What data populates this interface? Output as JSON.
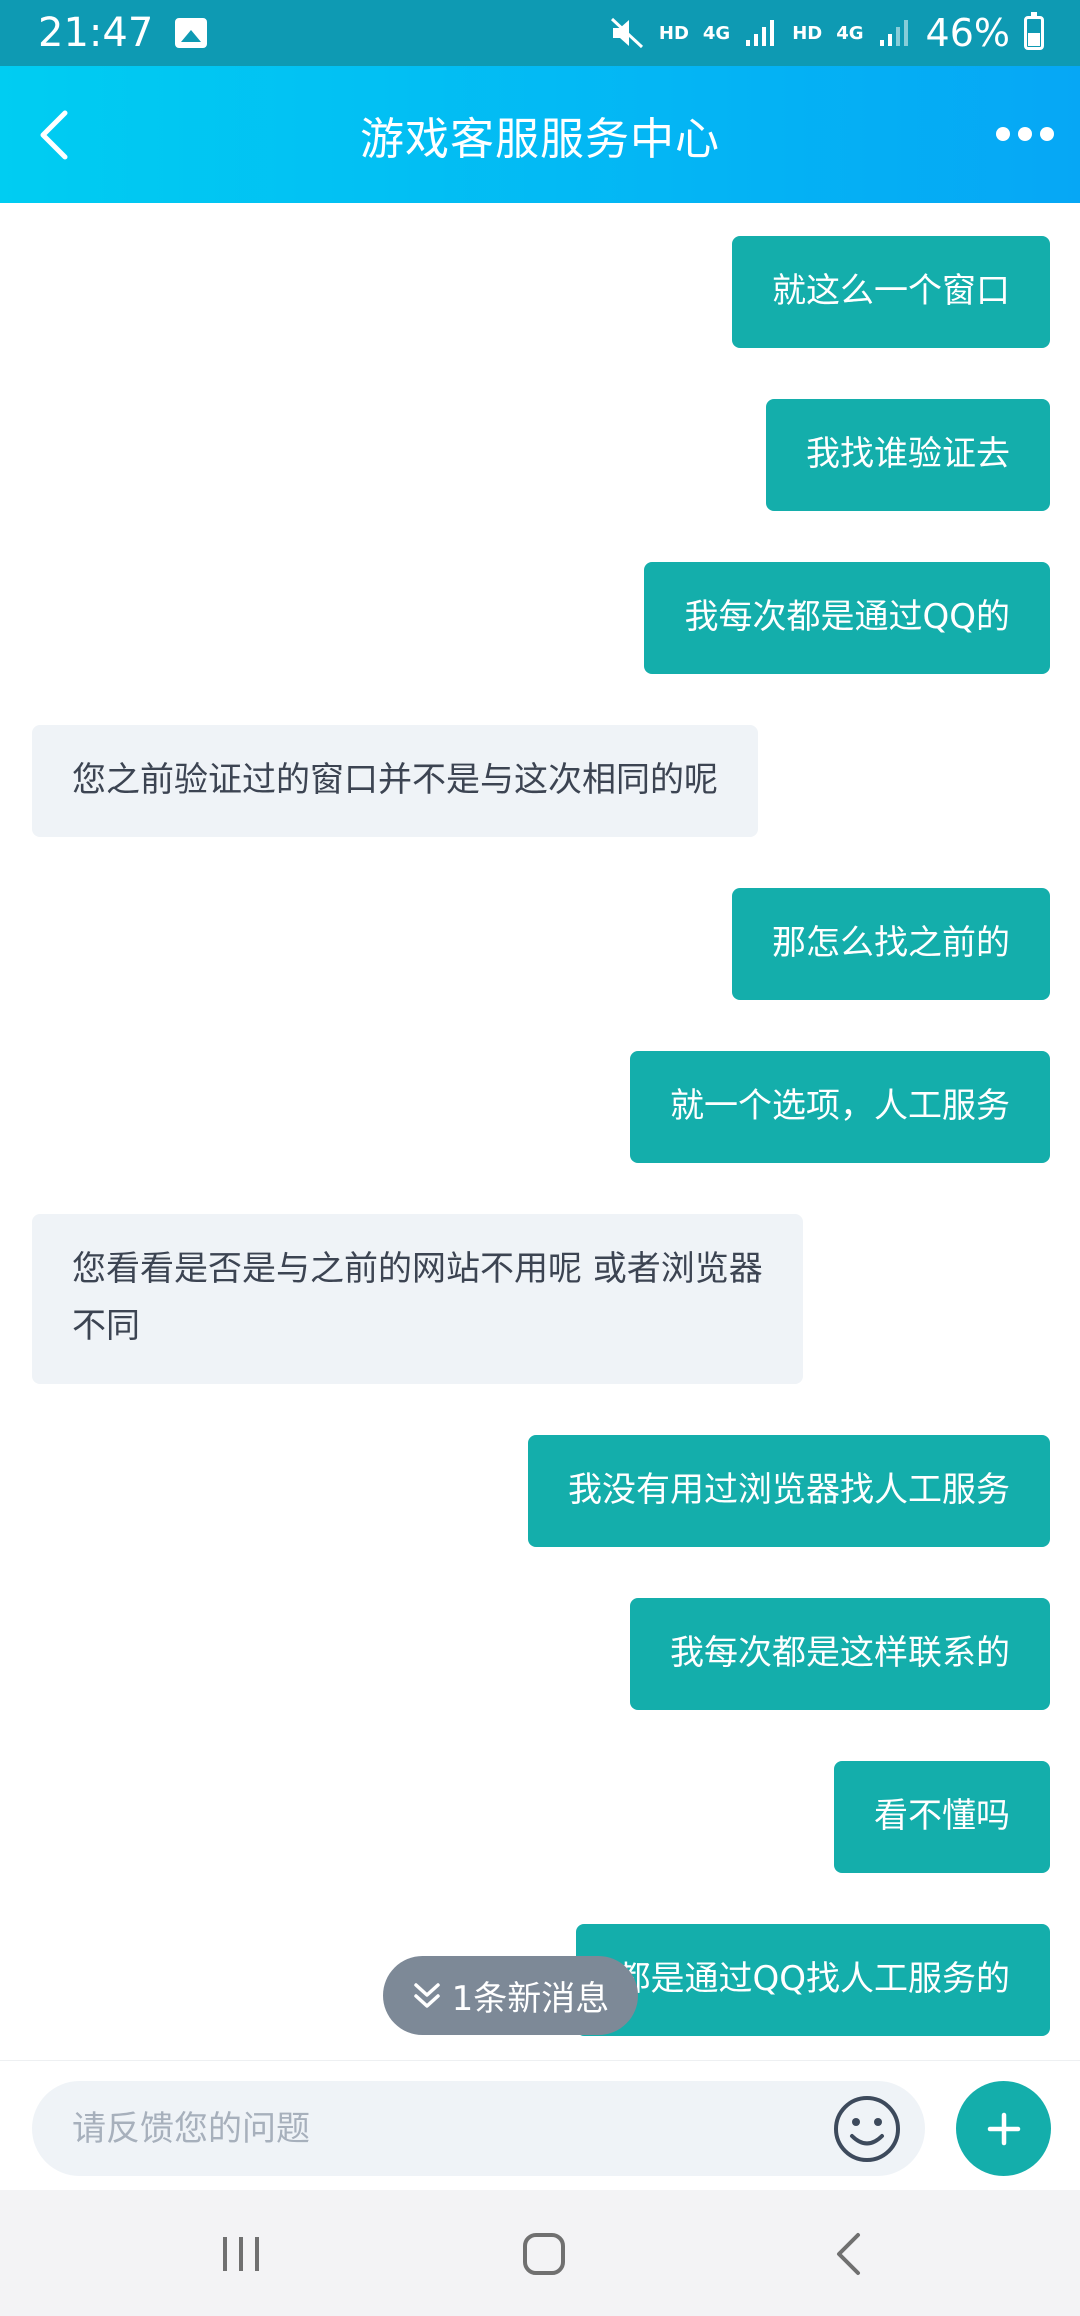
{
  "status_bar": {
    "time": "21:47",
    "net1": "HD",
    "net2": "4G",
    "net3": "HD",
    "net4": "4G",
    "battery": "46%"
  },
  "header": {
    "title": "游戏客服服务中心"
  },
  "messages": [
    {
      "from": "me",
      "text": "就这么一个窗口"
    },
    {
      "from": "me",
      "text": "我找谁验证去"
    },
    {
      "from": "me",
      "text": "我每次都是通过QQ的"
    },
    {
      "from": "them",
      "text": "您之前验证过的窗口并不是与这次相同的呢"
    },
    {
      "from": "me",
      "text": "那怎么找之前的"
    },
    {
      "from": "me",
      "text": "就一个选项，人工服务"
    },
    {
      "from": "them",
      "line1": "您看看是否是与之前的网站不用呢 或者浏览器",
      "line2": "不同"
    },
    {
      "from": "me",
      "text": "我没有用过浏览器找人工服务"
    },
    {
      "from": "me",
      "text": "我每次都是这样联系的"
    },
    {
      "from": "me",
      "text": "看不懂吗"
    },
    {
      "from": "me",
      "text": "都是通过QQ找人工服务的"
    }
  ],
  "new_message_pill": {
    "label": "1条新消息"
  },
  "input": {
    "placeholder": "请反馈您的问题"
  },
  "colors": {
    "accent": "#14aeab",
    "header_start": "#00cdf2",
    "header_end": "#06a7f5",
    "their_bubble": "#eff3f7"
  }
}
